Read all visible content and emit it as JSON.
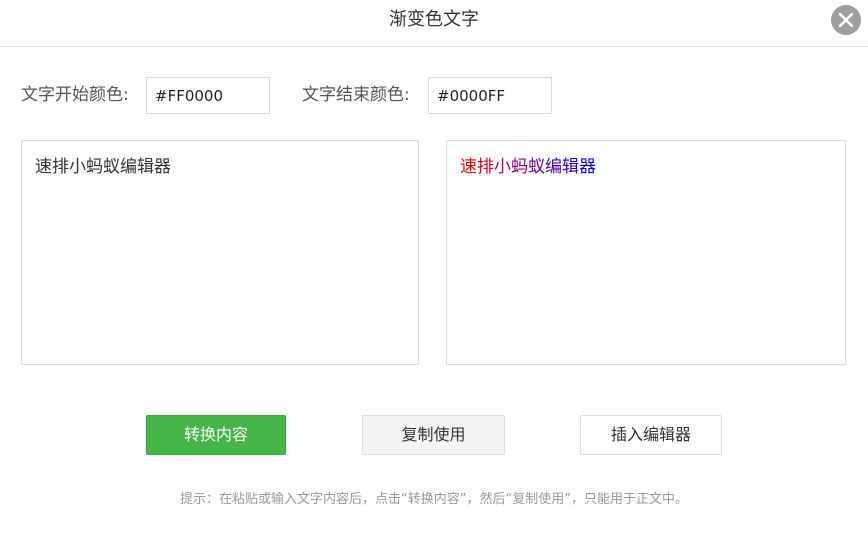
{
  "dialog": {
    "title": "渐变色文字",
    "close_icon": "close-icon"
  },
  "colors": {
    "start_label": "文字开始颜色:",
    "start_value": "#FF0000",
    "end_label": "文字结束颜色:",
    "end_value": "#0000FF"
  },
  "input_panel": {
    "text": "速排小蚂蚁编辑器"
  },
  "output_panel": {
    "text": "速排小蚂蚁编辑器"
  },
  "buttons": {
    "convert_label": "转换内容",
    "copy_label": "复制使用",
    "insert_label": "插入编辑器"
  },
  "hint": "提示：在粘贴或输入文字内容后，点击“转换内容”，然后“复制使用”，只能用于正文中。",
  "theme": {
    "accent": "#44b549",
    "close_bg": "#9e9e9e"
  }
}
